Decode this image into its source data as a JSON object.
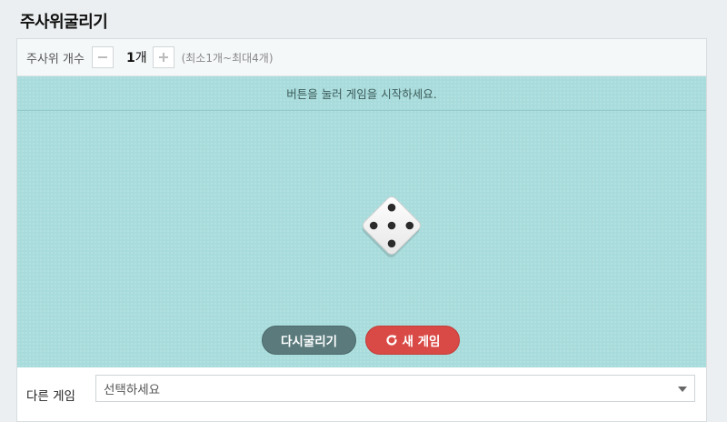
{
  "page": {
    "title": "주사위굴리기"
  },
  "toolbar": {
    "dice_count_label": "주사위 개수",
    "minus_icon": "minus-icon",
    "plus_icon": "plus-icon",
    "count_value": "1",
    "count_unit": "개",
    "range_text": "(최소1개~최대4개)"
  },
  "stage": {
    "hint": "버튼을 눌러 게임을 시작하세요.",
    "die_face": 5,
    "background_color": "#a8dcdc"
  },
  "buttons": {
    "reroll_label": "다시굴리기",
    "new_game_label": "새 게임",
    "new_game_icon": "refresh-icon",
    "reroll_color": "#5a7a7c",
    "new_game_color": "#d94a46"
  },
  "footer": {
    "label": "다른 게임",
    "select_value": "선택하세요"
  }
}
